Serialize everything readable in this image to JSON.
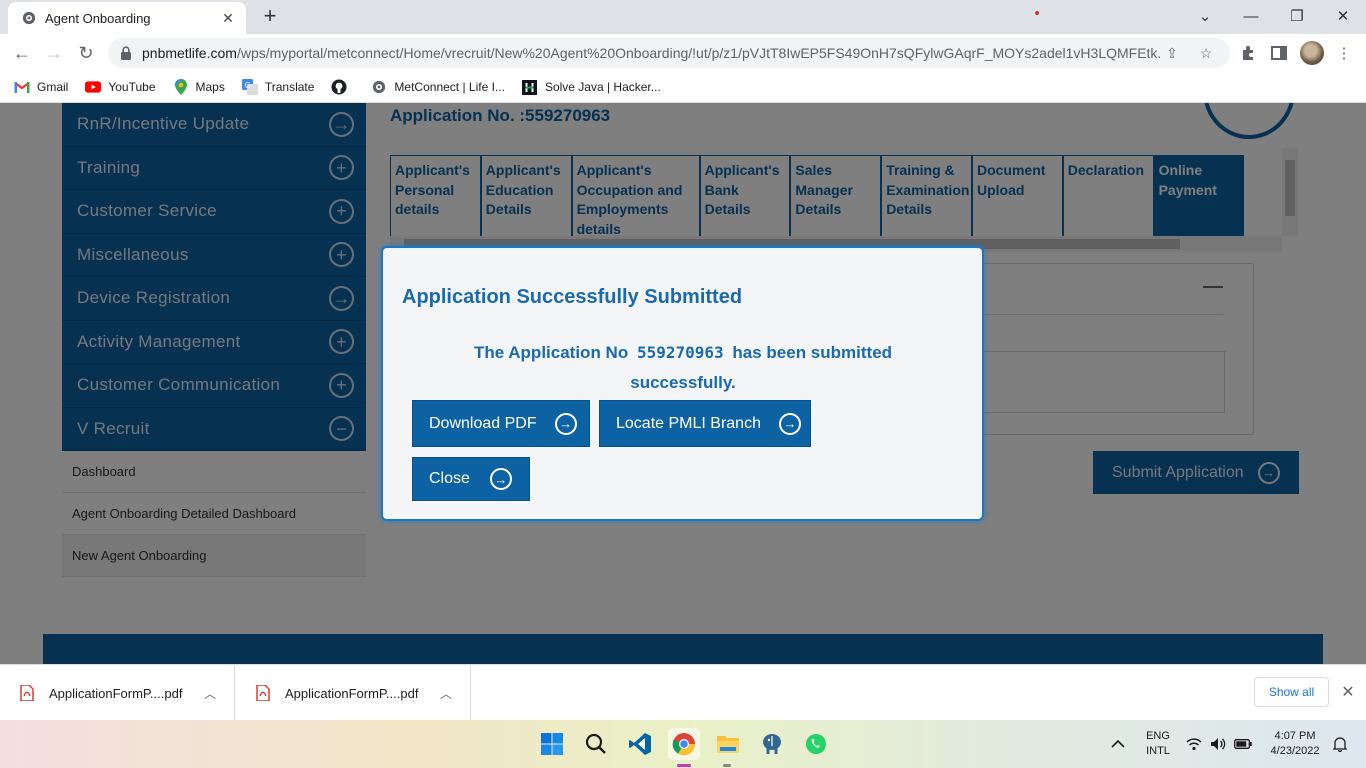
{
  "browser": {
    "tab_title": "Agent Onboarding",
    "url_domain": "pnbmetlife.com",
    "url_path": "/wps/myportal/metconnect/Home/vrecruit/New%20Agent%20Onboarding/!ut/p/z1/pVJtT8IwEP5FS49OnH7sQFylwGAqrF_MOYs2adel1vH3LQMFEtk...",
    "bookmarks": [
      {
        "label": "Gmail",
        "icon": "gmail-icon"
      },
      {
        "label": "YouTube",
        "icon": "youtube-icon"
      },
      {
        "label": "Maps",
        "icon": "maps-icon"
      },
      {
        "label": "Translate",
        "icon": "translate-icon"
      },
      {
        "label": "",
        "icon": "github-icon"
      },
      {
        "label": "MetConnect | Life I...",
        "icon": "globe-icon"
      },
      {
        "label": "Solve Java | Hacker...",
        "icon": "hackerrank-icon"
      }
    ]
  },
  "sidebar": {
    "items": [
      {
        "label": "RnR/Incentive Update",
        "icon": "arrow-right-circle-icon",
        "symbol": "→"
      },
      {
        "label": "Training",
        "icon": "plus-circle-icon",
        "symbol": "+"
      },
      {
        "label": "Customer Service",
        "icon": "plus-circle-icon",
        "symbol": "+"
      },
      {
        "label": "Miscellaneous",
        "icon": "plus-circle-icon",
        "symbol": "+"
      },
      {
        "label": "Device Registration",
        "icon": "arrow-right-circle-icon",
        "symbol": "→"
      },
      {
        "label": "Activity Management",
        "icon": "plus-circle-icon",
        "symbol": "+"
      },
      {
        "label": "Customer Communication",
        "icon": "plus-circle-icon",
        "symbol": "+"
      },
      {
        "label": "V Recruit",
        "icon": "minus-circle-icon",
        "symbol": "−"
      }
    ],
    "sub_items": [
      {
        "label": "Dashboard"
      },
      {
        "label": "Agent Onboarding Detailed Dashboard"
      },
      {
        "label": "New Agent Onboarding"
      }
    ]
  },
  "main": {
    "application_heading": "Application No. :559270963",
    "steps": [
      {
        "label": "Applicant's Personal details"
      },
      {
        "label": "Applicant's Education Details"
      },
      {
        "label": "Applicant's Occupation and Employments details"
      },
      {
        "label": "Applicant's Bank Details"
      },
      {
        "label": "Sales Manager Details"
      },
      {
        "label": "Training & Examination Details"
      },
      {
        "label": "Document Upload"
      },
      {
        "label": "Declaration"
      },
      {
        "label": "Online Payment"
      }
    ],
    "submit_label": "Submit Application"
  },
  "modal": {
    "title": "Application Successfully Submitted",
    "msg_prefix": "The Application No",
    "application_no": "559270963",
    "msg_suffix": "has been submitted successfully.",
    "download_label": "Download PDF",
    "locate_label": "Locate PMLI Branch",
    "close_label": "Close"
  },
  "downloads": {
    "files": [
      {
        "name": "ApplicationFormP....pdf"
      },
      {
        "name": "ApplicationFormP....pdf"
      }
    ],
    "show_all": "Show all"
  },
  "tray": {
    "lang_line1": "ENG",
    "lang_line2": "INTL",
    "time": "4:07 PM",
    "date": "4/23/2022"
  },
  "colors": {
    "brand_blue": "#0d62a3",
    "modal_border": "#1778c9"
  }
}
